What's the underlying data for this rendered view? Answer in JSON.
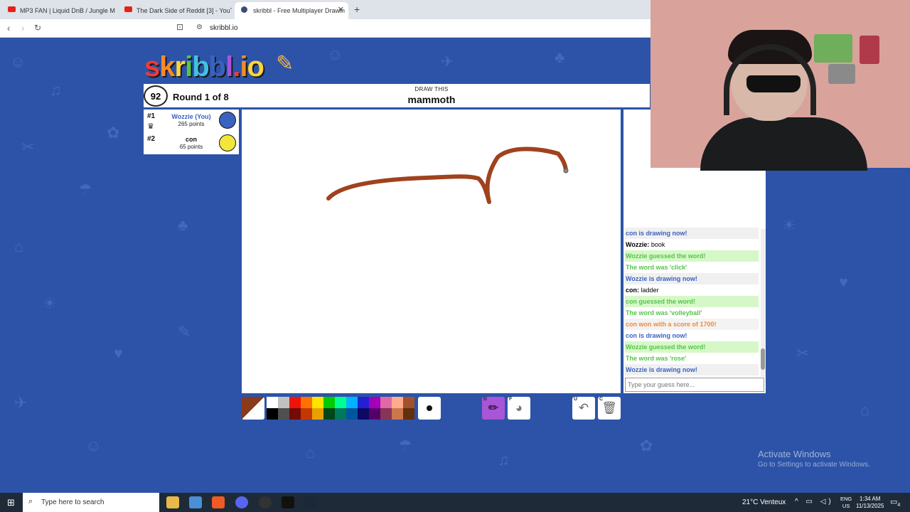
{
  "browser": {
    "tabs": [
      {
        "title": "MP3 FAN | Liquid DnB / Jungle M",
        "icon": "youtube-icon"
      },
      {
        "title": "The Dark Side of Reddit [3] - YouTub",
        "icon": "youtube-icon"
      },
      {
        "title": "skribbl - Free Multiplayer Drawin",
        "icon": "skribbl-icon"
      }
    ],
    "new_tab": "+",
    "url": "skribbl.io"
  },
  "game": {
    "logo": [
      "s",
      "k",
      "r",
      "i",
      "b",
      "b",
      "l",
      ".",
      "i",
      "o"
    ],
    "timer": "92",
    "round": "Round 1 of 8",
    "draw_this": "DRAW THIS",
    "word": "mammoth",
    "players": [
      {
        "rank": "#1",
        "name": "Wozzie (You)",
        "points": "265 points",
        "avatar_color": "#3a62c0"
      },
      {
        "rank": "#2",
        "name": "con",
        "points": "65 points",
        "avatar_color": "#f2e63a"
      }
    ]
  },
  "chat": {
    "messages": [
      {
        "text": "con is drawing now!",
        "style": "blue"
      },
      {
        "user": "Wozzie:",
        "text": "book",
        "style": "plain"
      },
      {
        "text": "Wozzie guessed the word!",
        "style": "green"
      },
      {
        "text": "The word was 'click'",
        "style": "green-light"
      },
      {
        "text": "Wozzie is drawing now!",
        "style": "blue-gray"
      },
      {
        "user": "con:",
        "text": "ladder",
        "style": "plain"
      },
      {
        "text": "con guessed the word!",
        "style": "green"
      },
      {
        "text": "The word was 'volleyball'",
        "style": "green-light"
      },
      {
        "text": "con won with a score of 1700!",
        "style": "orange"
      },
      {
        "text": "con is drawing now!",
        "style": "blue"
      },
      {
        "text": "Wozzie guessed the word!",
        "style": "green"
      },
      {
        "text": "The word was 'rose'",
        "style": "green-light"
      },
      {
        "text": "Wozzie is drawing now!",
        "style": "blue-gray"
      }
    ],
    "placeholder": "Type your guess here..."
  },
  "toolbar": {
    "current_color": "#8b3a1a",
    "palette": [
      "#ffffff",
      "#c1c1c1",
      "#ef130b",
      "#ff7100",
      "#ffe400",
      "#00cc00",
      "#00ff91",
      "#00b2ff",
      "#231fd3",
      "#a300ba",
      "#df69a7",
      "#ffac8e",
      "#a0522d",
      "#000000",
      "#505050",
      "#740b07",
      "#c23800",
      "#e8a200",
      "#004619",
      "#00785d",
      "#00569e",
      "#0e0865",
      "#550069",
      "#873554",
      "#cc774d",
      "#63300d"
    ],
    "tools": [
      {
        "key": "B",
        "name": "brush",
        "selected": true
      },
      {
        "key": "F",
        "name": "fill",
        "selected": false
      },
      {
        "key": "U",
        "name": "undo",
        "selected": false
      },
      {
        "key": "C",
        "name": "clear",
        "selected": false
      }
    ]
  },
  "windows": {
    "watermark_title": "Activate Windows",
    "watermark_sub": "Go to Settings to activate Windows.",
    "search": "Type here to search",
    "weather": "21°C  Venteux",
    "lang": [
      "ENG",
      "US"
    ],
    "time": "1:34 AM",
    "date": "11/13/2025",
    "notifications": "4"
  }
}
